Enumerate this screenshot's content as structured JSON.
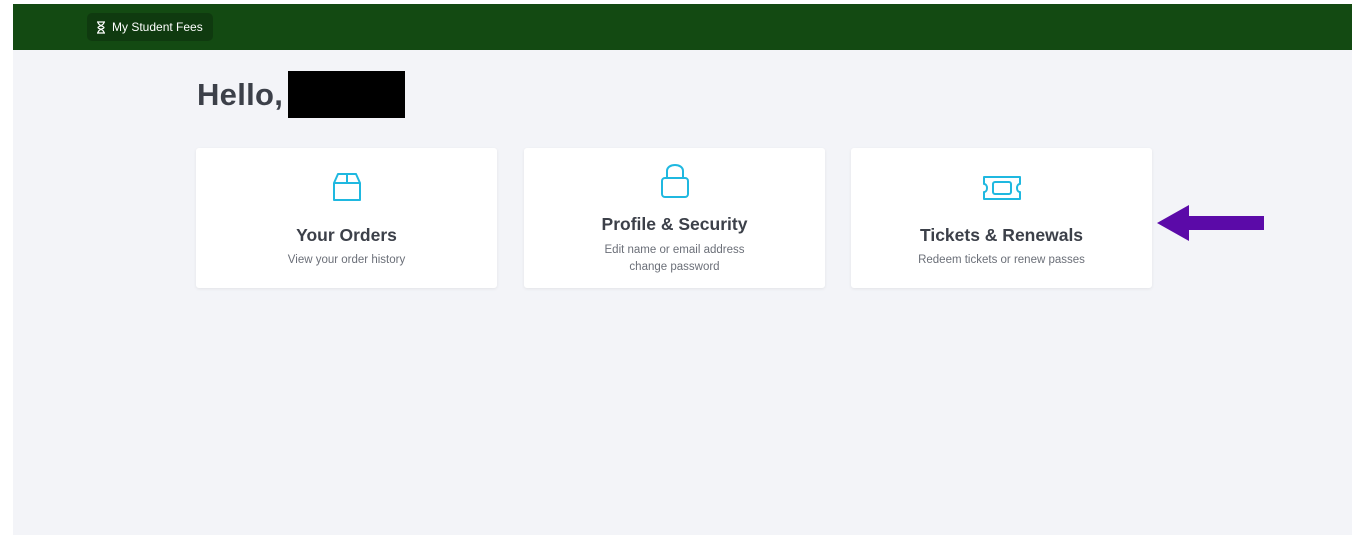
{
  "header": {
    "brand_label": "My Student Fees",
    "brand_icon": "hourglass-icon",
    "bg_color": "#134a12"
  },
  "greeting": {
    "text": "Hello,"
  },
  "cards": [
    {
      "icon": "box-icon",
      "title": "Your Orders",
      "desc_line1": "View your order history",
      "desc_line2": ""
    },
    {
      "icon": "lock-icon",
      "title": "Profile & Security",
      "desc_line1": "Edit name or email address",
      "desc_line2": "change password"
    },
    {
      "icon": "ticket-icon",
      "title": "Tickets & Renewals",
      "desc_line1": "Redeem tickets or renew passes",
      "desc_line2": ""
    }
  ],
  "colors": {
    "accent_icon": "#1fb8e0",
    "annotation_arrow": "#5b0aa8",
    "background": "#f3f4f8"
  }
}
